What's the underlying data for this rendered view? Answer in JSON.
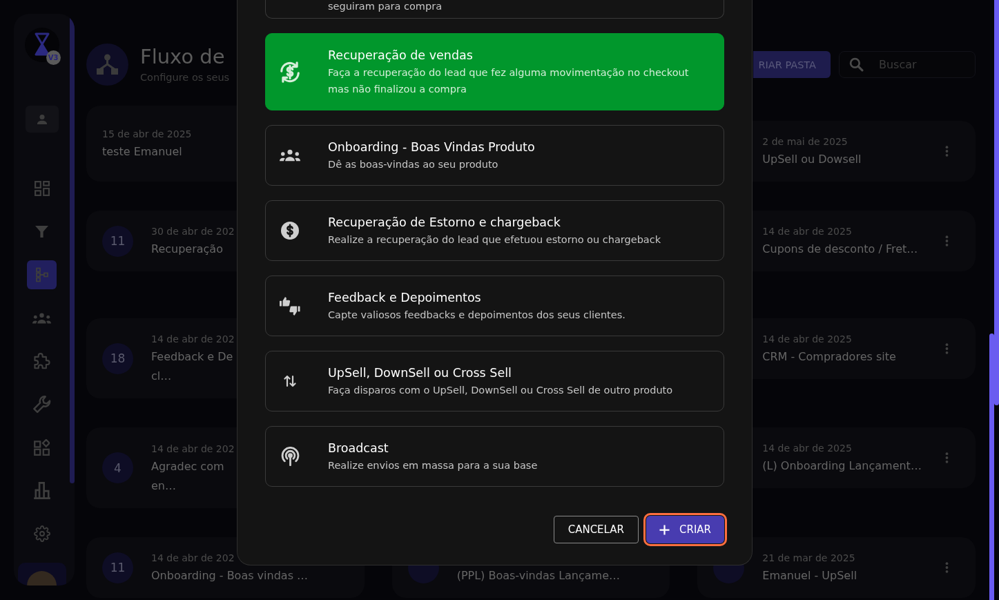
{
  "sidebar": {
    "logo_badge": "V3",
    "nav": [
      {
        "selected": false
      },
      {
        "selected": false
      },
      {
        "selected": true
      },
      {
        "selected": false
      },
      {
        "selected": false
      },
      {
        "selected": false
      },
      {
        "selected": false
      },
      {
        "selected": false
      },
      {
        "selected": false
      }
    ]
  },
  "header": {
    "title": "Fluxo de",
    "subtitle": "Configure os seus",
    "folder_button": "RIAR PASTA",
    "search": {
      "placeholder": "Buscar"
    }
  },
  "card_rows": [
    {
      "cards": [
        {
          "kind": "plain",
          "date": "15 de abr de 2025",
          "title_lines": [
            "teste Emanuel"
          ]
        },
        {
          "kind": "flow",
          "date": "2 de mai de 2025",
          "title_lines": [
            "UpSell ou Dowsell"
          ],
          "menu": true
        }
      ]
    },
    {
      "cards": [
        {
          "kind": "flow",
          "count": "11",
          "date": "30 de abr de 202",
          "title_lines": [
            "Recuperação"
          ]
        },
        {
          "kind": "flow",
          "date": "14 de abr de 2025",
          "title_lines": [
            "Cupons de desconto / Fret…"
          ],
          "menu": true
        }
      ]
    },
    {
      "cards": [
        {
          "kind": "flow",
          "count": "18",
          "date": "14 de abr de 202",
          "title_lines": [
            "Feedback e De",
            "cl…"
          ]
        },
        {
          "kind": "flow",
          "date": "14 de abr de 2025",
          "title_lines": [
            "CRM - Compradores site"
          ],
          "menu": true
        }
      ]
    },
    {
      "cards": [
        {
          "kind": "flow",
          "count": "4",
          "date": "14 de abr de 202",
          "title_lines": [
            "Agradec com",
            "en…"
          ]
        },
        {
          "kind": "flow",
          "date": "14 de abr de 2025",
          "title_lines": [
            "(L) Onboarding Lançament…"
          ],
          "menu": true
        }
      ]
    },
    {
      "cards": [
        {
          "kind": "flow",
          "count": "11",
          "date": "14 de abr de 202",
          "title_lines": [
            "Onboarding - Boas vindas …"
          ]
        },
        {
          "kind": "flow",
          "circle": true,
          "title_lines": [
            "(PPL) Boas-vindas Lançame…"
          ]
        },
        {
          "kind": "flow",
          "circle": true,
          "date": "21 de mar de 2025",
          "title_lines": [
            "Emanuel - UpSell"
          ],
          "menu": true
        }
      ]
    }
  ],
  "modal": {
    "options": [
      {
        "description": "seguiram para compra",
        "selected": false
      },
      {
        "title": "Recuperação de vendas",
        "description": "Faça a recuperação do lead que fez alguma movimentação no checkout mas não finalizou a compra",
        "selected": true
      },
      {
        "title": "Onboarding - Boas Vindas Produto",
        "description": "Dê as boas-vindas ao seu produto",
        "selected": false
      },
      {
        "title": "Recuperação de Estorno e chargeback",
        "description": "Realize a recuperação do lead que efetuou estorno ou chargeback",
        "selected": false
      },
      {
        "title": "Feedback e Depoimentos",
        "description": "Capte valiosos feedbacks e depoimentos dos seus clientes.",
        "selected": false
      },
      {
        "title": "UpSell, DownSell ou Cross Sell",
        "description": "Faça disparos com o UpSell, DownSell ou Cross Sell de outro produto",
        "selected": false
      },
      {
        "title": "Broadcast",
        "description": "Realize envios em massa para a sua base",
        "selected": false
      }
    ],
    "buttons": [
      {
        "kind": "secondary",
        "label": "CANCELAR"
      },
      {
        "kind": "primary",
        "label": "CRIAR",
        "focused": true
      }
    ]
  }
}
